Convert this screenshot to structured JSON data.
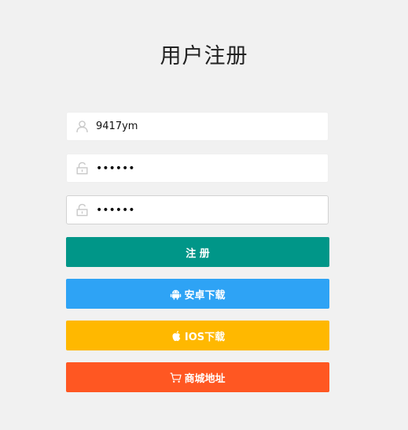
{
  "title": "用户注册",
  "form": {
    "username": {
      "value": "9417ym",
      "icon": "user-icon"
    },
    "password": {
      "value": "••••••",
      "icon": "lock-icon"
    },
    "confirm_password": {
      "value": "••••••",
      "icon": "lock-icon"
    }
  },
  "buttons": {
    "register": {
      "label": "注 册",
      "color": "#009688"
    },
    "android": {
      "label": "安卓下载",
      "icon": "android-icon",
      "color": "#2ea3f5"
    },
    "ios": {
      "label": "IOS下载",
      "icon": "apple-icon",
      "color": "#ffb800"
    },
    "shop": {
      "label": "商城地址",
      "icon": "cart-icon",
      "color": "#ff5722"
    }
  }
}
